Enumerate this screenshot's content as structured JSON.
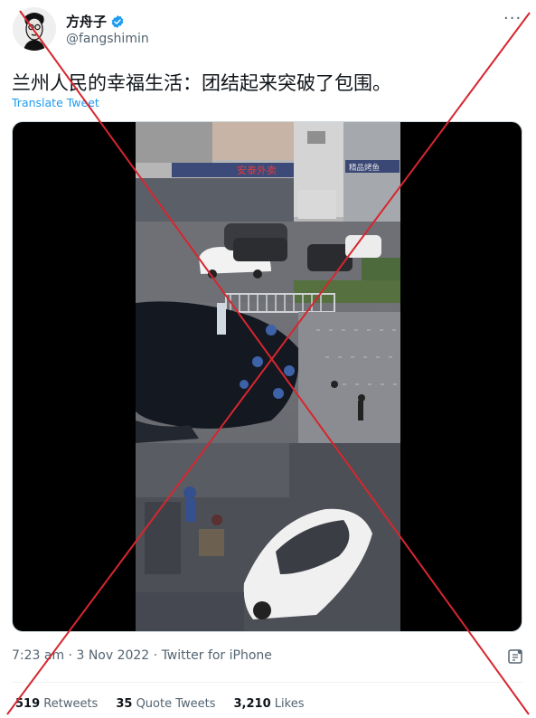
{
  "user": {
    "display_name": "方舟子",
    "handle": "@fangshimin",
    "verified": true
  },
  "tweet": {
    "text": "兰州人民的幸福生活：团结起来突破了包围。",
    "translate_label": "Translate Tweet",
    "media_type": "video",
    "timestamp": "7:23 am · 3 Nov 2022 · Twitter for iPhone"
  },
  "stats": {
    "retweets_count": "519",
    "retweets_label": "Retweets",
    "quotes_count": "35",
    "quotes_label": "Quote Tweets",
    "likes_count": "3,210",
    "likes_label": "Likes"
  },
  "video_signs": {
    "shop_sign": "安泰外卖",
    "shop_sign_right": "精品烤鱼"
  },
  "colors": {
    "link": "#1d9bf0",
    "muted": "#536471",
    "cross": "#d7262e"
  },
  "icons": [
    "verified-badge-icon",
    "more-icon",
    "share-icon"
  ]
}
